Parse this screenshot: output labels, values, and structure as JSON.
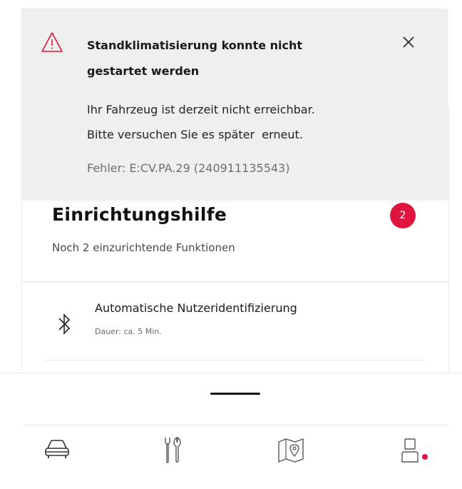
{
  "notification": {
    "title": "Standklimatisierung konnte nicht gestartet werden",
    "message_line1": "Ihr Fahrzeug ist derzeit nicht erreichbar.",
    "message_line2": "Bitte versuchen Sie es später  erneut.",
    "error": "Fehler: E:CV.PA.29 (240911135543)",
    "icon": "warning-triangle-icon",
    "close_icon": "close-icon"
  },
  "setup_help": {
    "title": "Einrichtungshilfe",
    "subtitle": "Noch 2 einzurichtende Funktionen",
    "badge_count": "2",
    "items": [
      {
        "title": "Automatische Nutzeridentifizierung",
        "duration": "Dauer: ca. 5 Min.",
        "icon": "bluetooth-icon"
      }
    ]
  },
  "tabbar": {
    "tabs": [
      {
        "name": "vehicle",
        "icon": "car-icon"
      },
      {
        "name": "services",
        "icon": "tools-icon"
      },
      {
        "name": "map",
        "icon": "map-icon"
      },
      {
        "name": "profile",
        "icon": "user-icon",
        "has_notification": true
      }
    ]
  },
  "colors": {
    "accent": "#e0153f",
    "notification_bg": "#efefef"
  }
}
